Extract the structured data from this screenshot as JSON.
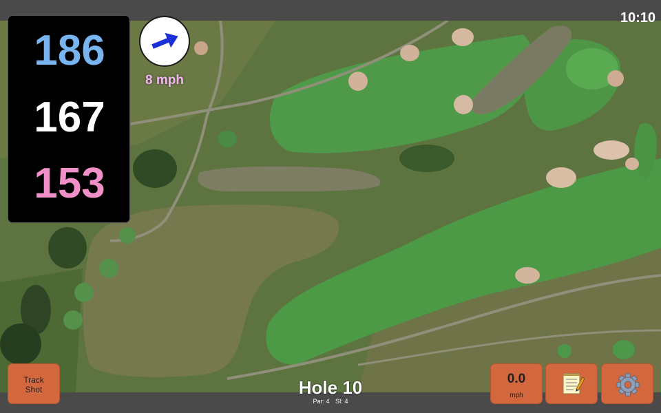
{
  "status": {
    "time": "10:10"
  },
  "distances": {
    "back": "186",
    "middle": "167",
    "front": "153"
  },
  "wind": {
    "speed_label": "8 mph",
    "direction_icon": "wind-arrow-icon"
  },
  "hole": {
    "title": "Hole 10",
    "par_label": "Par: 4",
    "si_label": "SI: 4"
  },
  "buttons": {
    "track_shot_line1": "Track",
    "track_shot_line2": "Shot",
    "speed_value": "0.0",
    "speed_unit": "mph",
    "scorecard_icon": "notepad-icon",
    "settings_icon": "gear-icon"
  },
  "colors": {
    "back_distance": "#78b4f0",
    "middle_distance": "#ffffff",
    "front_distance": "#f08fc8",
    "button_orange": "#d3683e"
  }
}
